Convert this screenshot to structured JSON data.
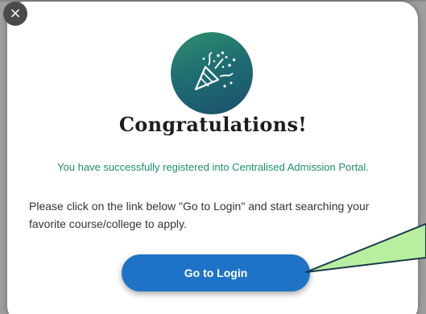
{
  "modal": {
    "close_label": "×",
    "title": "Congratulations!",
    "success_message": "You have successfully registered into Centralised Admission Portal.",
    "instructions": "Please click on the link below \"Go to Login\" and start searching your favorite course/college to apply.",
    "login_button_label": "Go to Login",
    "hero_icon": "party-popper-icon"
  },
  "colors": {
    "success_text": "#1f8f6a",
    "button_bg": "#1f73c7",
    "hero_gradient_start": "#2f8f6d",
    "hero_gradient_end": "#1a4f6d",
    "callout_fill": "#b8eea0"
  }
}
